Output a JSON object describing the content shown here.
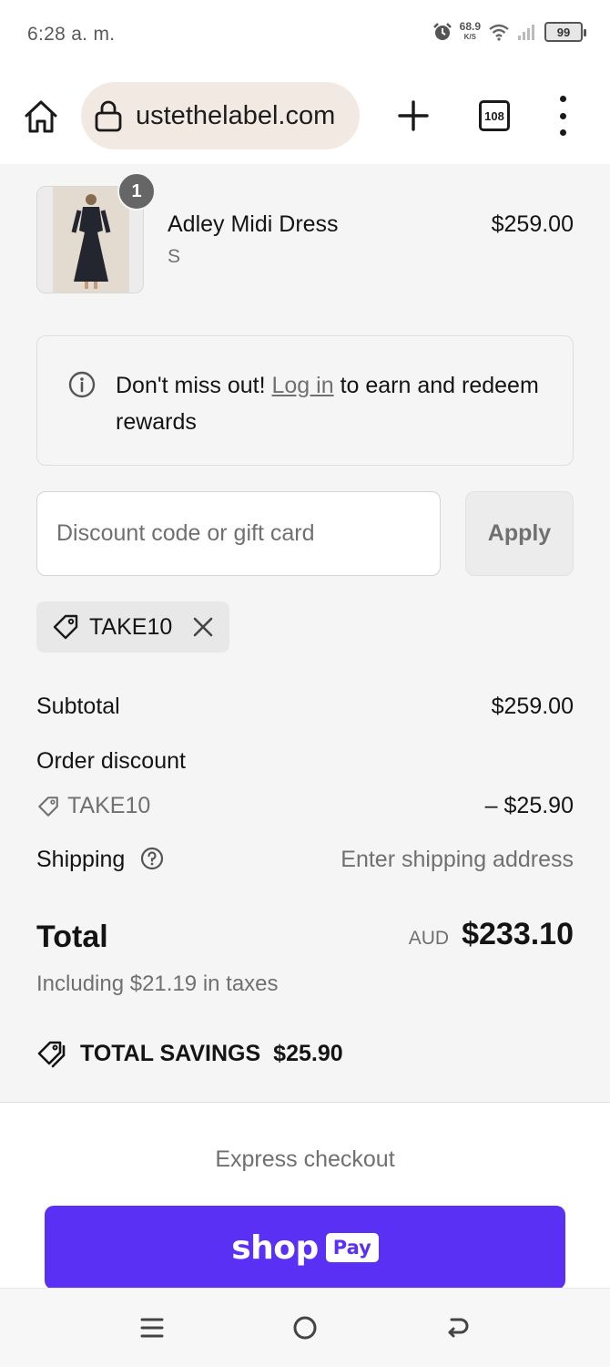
{
  "status_bar": {
    "time": "6:28 a. m.",
    "net_speed_value": "68.9",
    "net_speed_unit": "K/S",
    "battery": "99",
    "icons": [
      "alarm-icon",
      "wifi-icon",
      "signal-icon",
      "battery-icon"
    ]
  },
  "browser": {
    "url": "ustethelabel.com",
    "tab_count": "108",
    "icons": [
      "home-icon",
      "lock-icon",
      "plus-icon",
      "more-icon"
    ]
  },
  "product": {
    "quantity": "1",
    "name": "Adley Midi Dress",
    "variant": "S",
    "price": "$259.00"
  },
  "rewards_notice": {
    "text_before": "Don't miss out! ",
    "link": "Log in",
    "text_after": " to earn and redeem rewards"
  },
  "discount": {
    "placeholder": "Discount code or gift card",
    "value": "",
    "apply_label": "Apply",
    "applied_code": "TAKE10"
  },
  "summary": {
    "subtotal_label": "Subtotal",
    "subtotal_value": "$259.00",
    "order_discount_label": "Order discount",
    "discount_code": "TAKE10",
    "discount_value": "– $25.90",
    "shipping_label": "Shipping",
    "shipping_value": "Enter shipping address",
    "total_label": "Total",
    "currency": "AUD",
    "total_value": "$233.10",
    "taxes_text": "Including $21.19 in taxes",
    "savings_label": "TOTAL SAVINGS",
    "savings_value": "$25.90"
  },
  "express": {
    "title": "Express checkout",
    "shop_word": "shop",
    "pay_word": "Pay",
    "brand_color": "#5a31f4"
  },
  "nav": {
    "icons": [
      "recents-icon",
      "home-circle-icon",
      "back-icon"
    ]
  }
}
